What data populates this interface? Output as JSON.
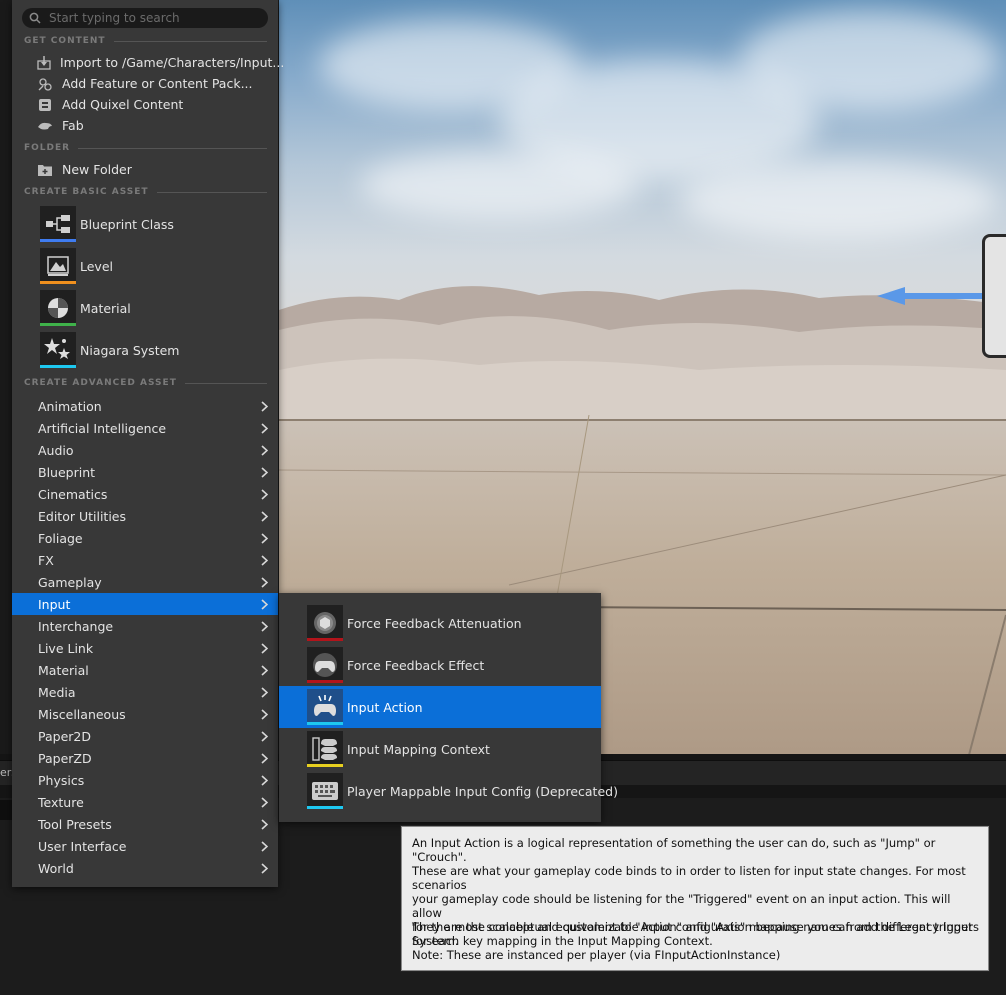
{
  "search": {
    "placeholder": "Start typing to search",
    "value": ""
  },
  "sections": {
    "get_content": "GET CONTENT",
    "folder": "FOLDER",
    "basic": "CREATE BASIC ASSET",
    "advanced": "CREATE ADVANCED ASSET"
  },
  "get_content_items": [
    {
      "label": "Import to /Game/Characters/Input...",
      "icon": "import-icon"
    },
    {
      "label": "Add Feature or Content Pack...",
      "icon": "content-pack-icon"
    },
    {
      "label": "Add Quixel Content",
      "icon": "quixel-icon"
    },
    {
      "label": "Fab",
      "icon": "fab-icon"
    }
  ],
  "folder_items": [
    {
      "label": "New Folder",
      "icon": "new-folder-icon"
    }
  ],
  "basic_assets": [
    {
      "label": "Blueprint Class",
      "icon": "blueprint-class-icon",
      "color": "#3f7cf0"
    },
    {
      "label": "Level",
      "icon": "level-icon",
      "color": "#f0901e"
    },
    {
      "label": "Material",
      "icon": "material-icon",
      "color": "#3fb24a"
    },
    {
      "label": "Niagara System",
      "icon": "niagara-system-icon",
      "color": "#1ec8f0"
    }
  ],
  "advanced_categories": [
    "Animation",
    "Artificial Intelligence",
    "Audio",
    "Blueprint",
    "Cinematics",
    "Editor Utilities",
    "Foliage",
    "FX",
    "Gameplay",
    "Input",
    "Interchange",
    "Live Link",
    "Material",
    "Media",
    "Miscellaneous",
    "Paper2D",
    "PaperZD",
    "Physics",
    "Texture",
    "Tool Presets",
    "User Interface",
    "World"
  ],
  "selected_category": "Input",
  "submenu_items": [
    {
      "label": "Force Feedback Attenuation",
      "icon": "force-feedback-attenuation-icon",
      "color": "#b3141b"
    },
    {
      "label": "Force Feedback Effect",
      "icon": "force-feedback-effect-icon",
      "color": "#b3141b"
    },
    {
      "label": "Input Action",
      "icon": "input-action-icon",
      "color": "#1ec8f0"
    },
    {
      "label": "Input Mapping Context",
      "icon": "input-mapping-context-icon",
      "color": "#e8d020"
    },
    {
      "label": "Player Mappable Input Config (Deprecated)",
      "icon": "player-mappable-config-icon",
      "color": "#1ec8f0"
    }
  ],
  "selected_submenu": "Input Action",
  "tooltip": {
    "paragraph1": "An Input Action is a logical representation of something the user can do, such as \"Jump\" or \"Crouch\".\nThese are what your gameplay code binds to in order to listen for input state changes. For most scenarios\nyour gameplay code should be listening for the \"Triggered\" event on an input action. This will allow\nfor the most scalable and customizable input configuration because you can add different triggers\nfor each key mapping in the Input Mapping Context.",
    "paragraph2": "They are the conceptual equivalent to \"Action\" and \"Axis\" mapping names from the Legacy Input System.",
    "paragraph3": "Note: These are instanced per player (via FInputActionInstance)"
  },
  "bottom_panel": {
    "tab_fragment": "ers"
  },
  "colors": {
    "selection": "#0b6fd8",
    "menu_bg": "#383838",
    "tooltip_bg": "#ececec"
  }
}
